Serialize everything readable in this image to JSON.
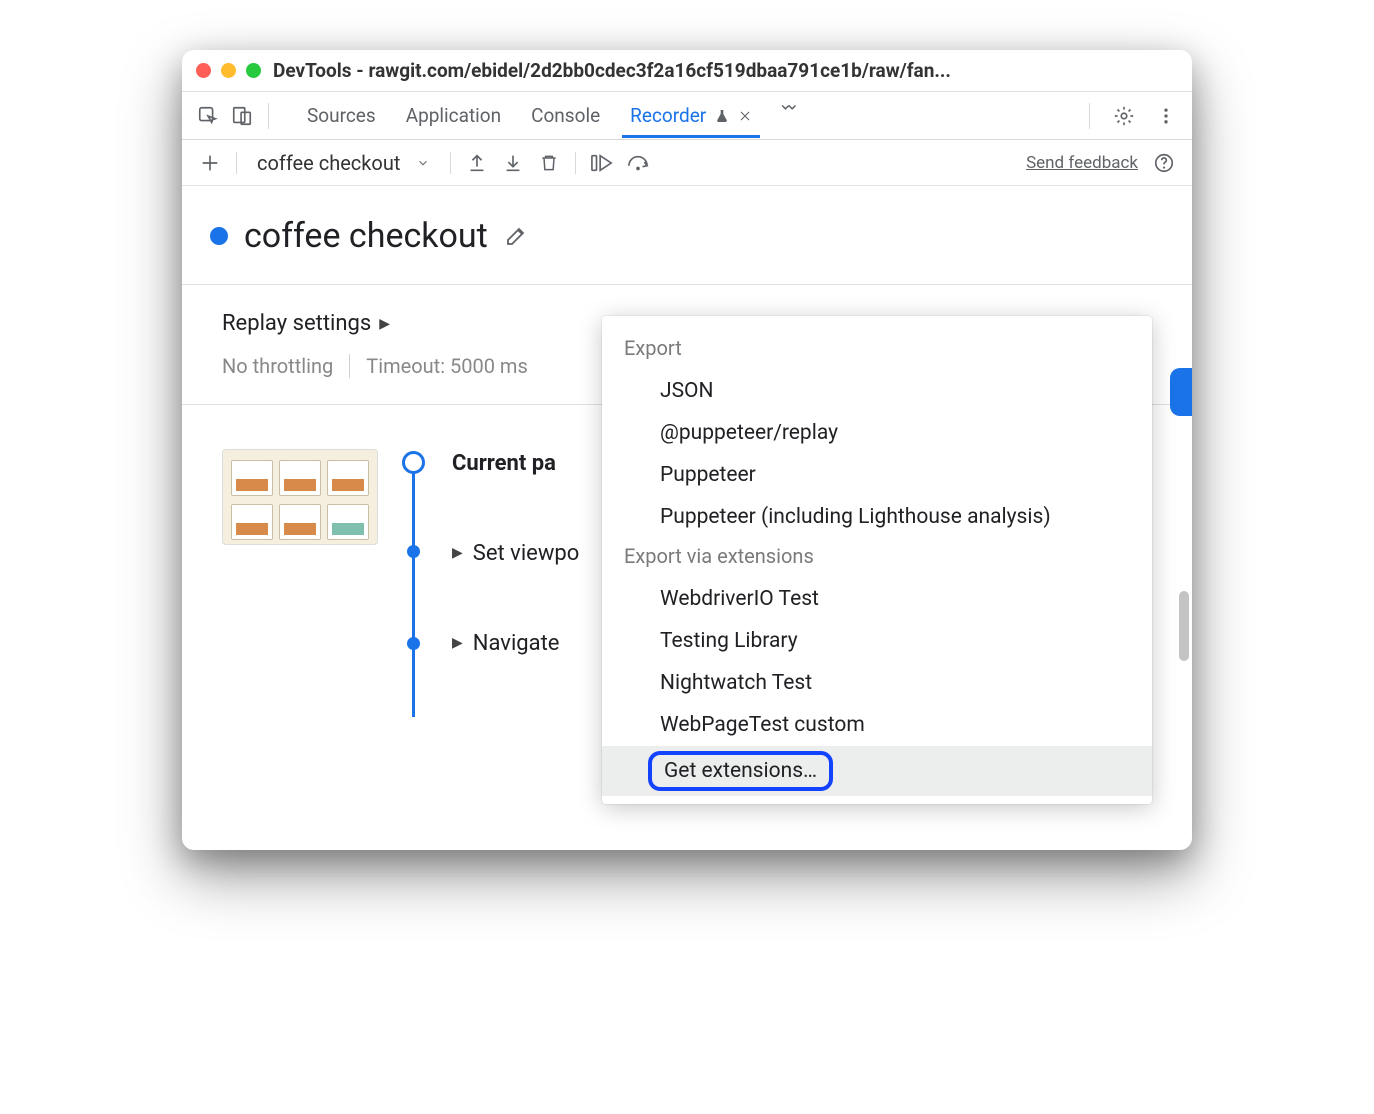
{
  "window": {
    "title": "DevTools - rawgit.com/ebidel/2d2bb0cdec3f2a16cf519dbaa791ce1b/raw/fan..."
  },
  "tabs": {
    "items": [
      "Sources",
      "Application",
      "Console"
    ],
    "active": "Recorder"
  },
  "toolbar": {
    "recording_name": "coffee checkout",
    "send_feedback": "Send feedback"
  },
  "heading": "coffee checkout",
  "settings": {
    "title": "Replay settings",
    "throttling": "No throttling",
    "timeout": "Timeout: 5000 ms"
  },
  "steps": {
    "current": "Current pa",
    "items": [
      "Set viewpo",
      "Navigate"
    ]
  },
  "dropdown": {
    "section1": "Export",
    "group1": [
      "JSON",
      "@puppeteer/replay",
      "Puppeteer",
      "Puppeteer (including Lighthouse analysis)"
    ],
    "section2": "Export via extensions",
    "group2": [
      "WebdriverIO Test",
      "Testing Library",
      "Nightwatch Test",
      "WebPageTest custom"
    ],
    "get_ext": "Get extensions…"
  }
}
